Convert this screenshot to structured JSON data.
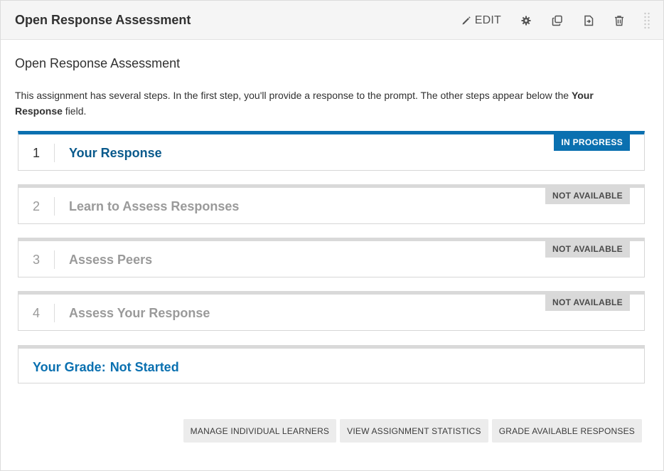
{
  "header": {
    "title": "Open Response Assessment",
    "edit_label": "EDIT",
    "icons": [
      "pencil-icon",
      "gear-icon",
      "duplicate-icon",
      "move-icon",
      "trash-icon",
      "drag-handle-icon"
    ]
  },
  "component": {
    "title": "Open Response Assessment",
    "intro_before": "This assignment has several steps. In the first step, you'll provide a response to the prompt. The other steps appear below the ",
    "intro_bold": "Your Response",
    "intro_after": " field."
  },
  "steps": [
    {
      "number": "1",
      "label": "Your Response",
      "status": "IN PROGRESS",
      "active": true
    },
    {
      "number": "2",
      "label": "Learn to Assess Responses",
      "status": "NOT AVAILABLE",
      "active": false
    },
    {
      "number": "3",
      "label": "Assess Peers",
      "status": "NOT AVAILABLE",
      "active": false
    },
    {
      "number": "4",
      "label": "Assess Your Response",
      "status": "NOT AVAILABLE",
      "active": false
    }
  ],
  "grade": {
    "label": "Your Grade:",
    "value": "Not Started"
  },
  "actions": {
    "manage_learners": "MANAGE INDIVIDUAL LEARNERS",
    "view_statistics": "VIEW ASSIGNMENT STATISTICS",
    "grade_responses": "GRADE AVAILABLE RESPONSES"
  },
  "colors": {
    "accent": "#0a70b0",
    "accent_dark": "#0a5a8c",
    "disabled_text": "#9a9a9a",
    "badge_gray": "#d9d9d9"
  }
}
